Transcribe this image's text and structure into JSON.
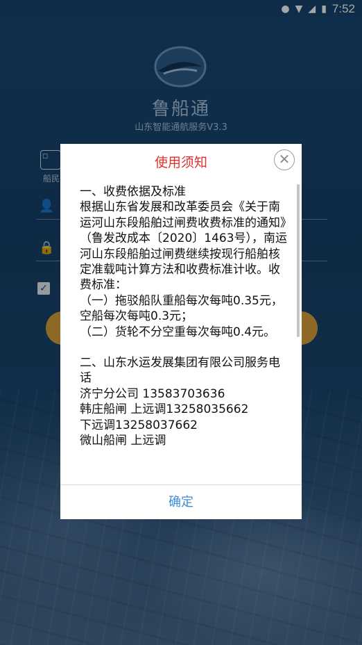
{
  "status_bar": {
    "time": "7:52",
    "icons": [
      "location-icon",
      "wifi-icon",
      "signal-icon",
      "battery-icon"
    ]
  },
  "app": {
    "name": "鲁船通",
    "subtitle": "山东智能通航服务V3.3",
    "login_tab_label": "船民"
  },
  "dialog": {
    "title": "使用须知",
    "body": [
      "一、收费依据及标准",
      "根据山东省发展和改革委员会《关于南运河山东段船舶过闸费收费标准的通知》（鲁发改成本〔2020〕1463号），南运河山东段船舶过闸费继续按现行船舶核定准载吨计算方法和收费标准计收。收费标准：",
      "（一）拖驳船队重船每次每吨0.35元，空船每次每吨0.3元；",
      "（二）货轮不分空重每次每吨0.4元。",
      "",
      "二、山东水运发展集团有限公司服务电话",
      "济宁分公司 13583703636",
      "韩庄船闸 上远调13258035662",
      "下远调13258037662",
      "微山船闸 上远调"
    ],
    "confirm_label": "确定"
  },
  "colors": {
    "title_red": "#e0312f",
    "confirm_blue": "#3a8fd6",
    "login_button": "#d9a23a"
  }
}
